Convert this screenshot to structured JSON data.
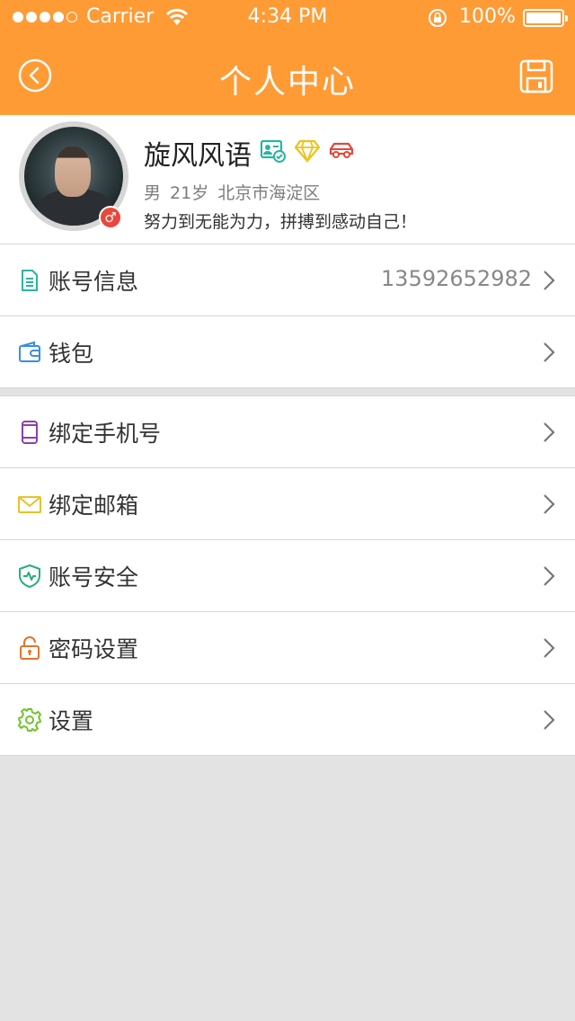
{
  "status_bar": {
    "carrier": "Carrier",
    "time": "4:34 PM",
    "battery": "100%"
  },
  "header": {
    "title": "个人中心",
    "back_icon": "back-circle-icon",
    "save_icon": "save-disk-icon",
    "color": "#fe9b35"
  },
  "profile": {
    "name": "旋风风语",
    "gender": "男",
    "age": "21岁",
    "location": "北京市海淀区",
    "motto": "努力到无能为力，拼搏到感动自己！",
    "gender_badge": "♂",
    "badges": [
      "id-verified-icon",
      "diamond-icon",
      "car-icon"
    ]
  },
  "groups": [
    {
      "items": [
        {
          "label": "账号信息",
          "value": "13592652982",
          "icon": "document-icon",
          "color": "#2ab49f"
        },
        {
          "label": "钱包",
          "value": "",
          "icon": "wallet-icon",
          "color": "#3a8fe0"
        }
      ]
    },
    {
      "items": [
        {
          "label": "绑定手机号",
          "value": "",
          "icon": "phone-icon",
          "color": "#8b3fb4"
        },
        {
          "label": "绑定邮箱",
          "value": "",
          "icon": "mail-icon",
          "color": "#e9c227"
        },
        {
          "label": "账号安全",
          "value": "",
          "icon": "shield-icon",
          "color": "#24b07a"
        },
        {
          "label": "密码设置",
          "value": "",
          "icon": "lock-icon",
          "color": "#e6742a"
        },
        {
          "label": "设置",
          "value": "",
          "icon": "gear-icon",
          "color": "#6fc42c"
        }
      ]
    }
  ]
}
